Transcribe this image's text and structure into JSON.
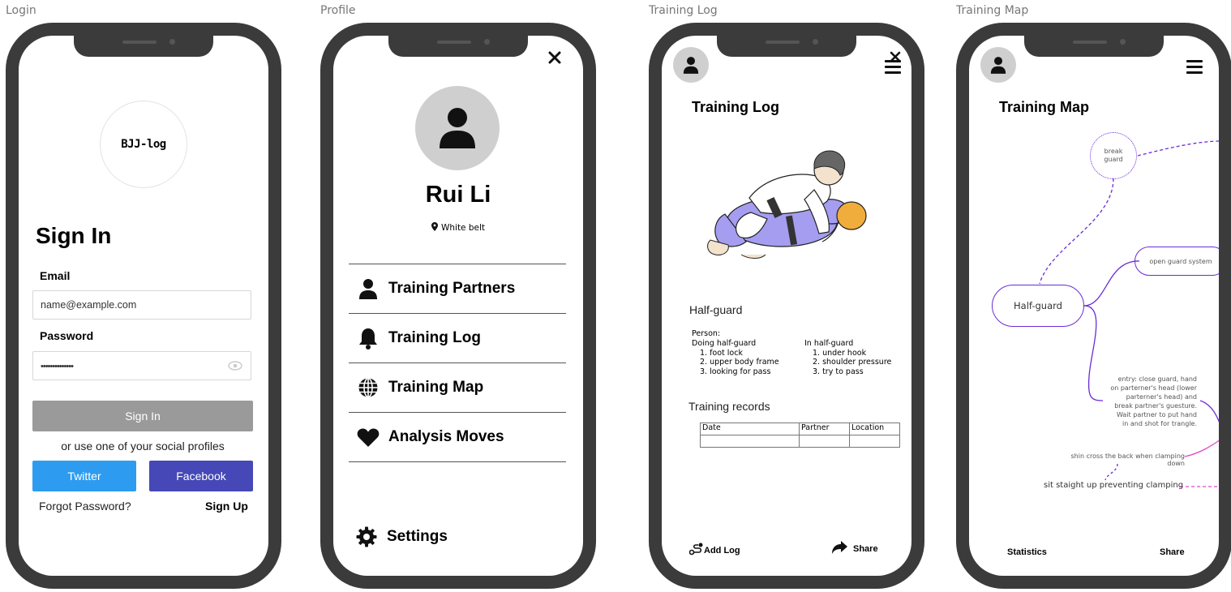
{
  "frames": {
    "login": "Login",
    "profile": "Profile",
    "log": "Training Log",
    "map": "Training Map"
  },
  "login": {
    "logo": "BJJ-log",
    "title": "Sign In",
    "email_label": "Email",
    "email_value": "name@example.com",
    "password_label": "Password",
    "password_value": "••••••••••••••",
    "signin_button": "Sign In",
    "social_text": "or use one of your social profiles",
    "twitter": "Twitter",
    "facebook": "Facebook",
    "forgot": "Forgot Password?",
    "signup": "Sign Up",
    "colors": {
      "twitter": "#2d9cf0",
      "facebook": "#4548b6",
      "signin": "#9a9a9a"
    }
  },
  "profile": {
    "name": "Rui Li",
    "belt": "White belt",
    "menu": [
      {
        "label": "Training Partners",
        "icon": "user-icon"
      },
      {
        "label": "Training Log",
        "icon": "bell-icon"
      },
      {
        "label": "Training Map",
        "icon": "globe-icon"
      },
      {
        "label": "Analysis Moves",
        "icon": "heart-icon"
      }
    ],
    "settings": "Settings"
  },
  "log": {
    "title": "Training Log",
    "position": "Half-guard",
    "person_label": "Person:",
    "doing_title": "Doing half-guard",
    "doing_steps": [
      "1. foot lock",
      "2. upper body frame",
      "3. looking for pass"
    ],
    "in_title": "In half-guard",
    "in_steps": [
      "1. under hook",
      "2. shoulder pressure",
      "3. try to pass"
    ],
    "records_title": "Training records",
    "records_headers": [
      "Date",
      "Partner",
      "Location"
    ],
    "add_log": "Add Log",
    "share": "Share"
  },
  "map": {
    "title": "Training Map",
    "break_guard": "break guard",
    "open_guard": "open guard system",
    "half_guard": "Half-guard",
    "entry_note": "entry: close guard, hand on parterner's head (lower parterner's head) and break partner's guesture. Wait partner to put hand in and shot for trangle.",
    "shin_note": "shin cross the back when clamping down",
    "sit_note": "sit staight up preventing clamping",
    "statistics": "Statistics",
    "share": "Share",
    "colors": {
      "purple": "#6a2bd8",
      "pink": "#e546c8"
    }
  }
}
